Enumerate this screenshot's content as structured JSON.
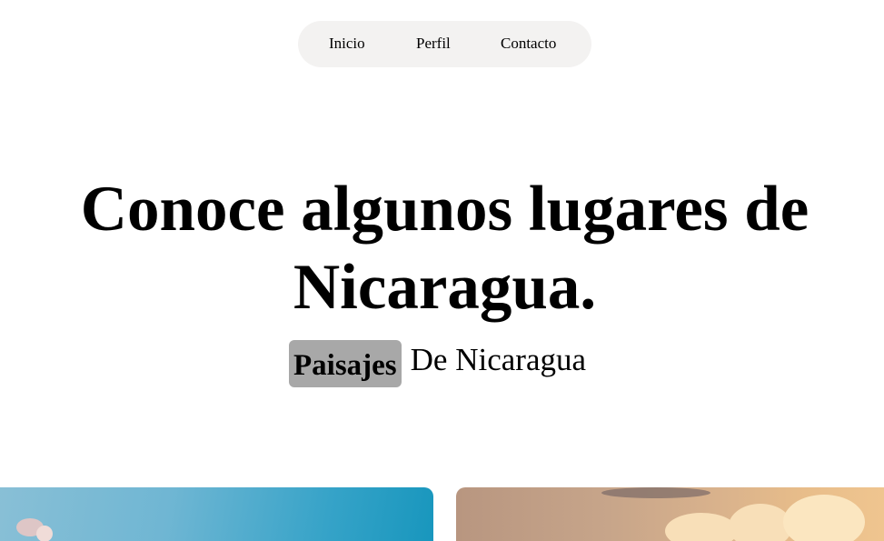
{
  "nav": {
    "items": [
      {
        "label": "Inicio"
      },
      {
        "label": "Perfil"
      },
      {
        "label": "Contacto"
      }
    ]
  },
  "hero": {
    "title": "Conoce algunos lugares de Nicaragua.",
    "badge": "Paisajes",
    "subtitle": "De Nicaragua"
  },
  "colors": {
    "nav_bg": "#f3f2f1",
    "badge_bg": "#a8a8a8",
    "page_bg": "#ffffff"
  }
}
